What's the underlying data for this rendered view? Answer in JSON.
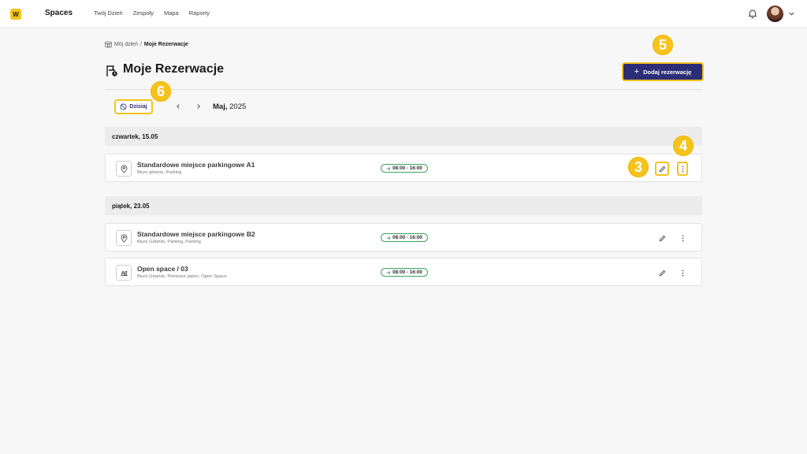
{
  "header": {
    "logo_letter": "W",
    "app_name": "Spaces",
    "nav": [
      "Twój Dzień",
      "Zespoły",
      "Mapa",
      "Raporty"
    ]
  },
  "breadcrumb": {
    "parent": "Mój dzień",
    "separator": "/",
    "current": "Moje Rezerwacje"
  },
  "page": {
    "title": "Moje Rezerwacje",
    "add_button": "Dodaj rezerwację",
    "today_button": "Dzisiaj",
    "month": "Maj,",
    "year": "2025"
  },
  "markers": {
    "edit": "3",
    "more": "4",
    "add": "5",
    "today": "6"
  },
  "days": [
    {
      "label": "czwartek, 15.05",
      "reservations": [
        {
          "name": "Standardowe miejsce parkingowe A1",
          "location": "Biuro główne, Parking",
          "time": "08:00 - 16:00",
          "icon": "parking-pin-icon"
        }
      ]
    },
    {
      "label": "piątek, 23.05",
      "reservations": [
        {
          "name": "Standardowe miejsce parkingowe B2",
          "location": "Biuro Gdańsk, Parking, Parking",
          "time": "08:00 - 16:00",
          "icon": "parking-pin-icon"
        },
        {
          "name": "Open space / 03",
          "location": "Biuro Gdańsk, Pierwsze piętro, Open Space",
          "time": "08:00 - 16:00",
          "icon": "desk-icon"
        }
      ]
    }
  ],
  "colors": {
    "accent": "#f6c21c",
    "primary": "#2c2d77",
    "time_badge": "#3aa561"
  }
}
